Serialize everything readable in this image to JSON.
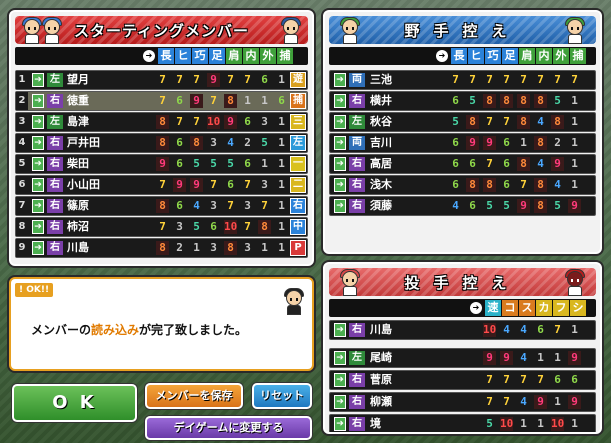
{
  "starting": {
    "title": "スターティングメンバー",
    "headers": [
      "長",
      "ヒ",
      "巧",
      "足",
      "肩",
      "内",
      "外",
      "捕"
    ],
    "rows": [
      {
        "num": "1",
        "hand": "左",
        "name": "望月",
        "stats": [
          "7",
          "7",
          "7",
          "9",
          "7",
          "7",
          "6",
          "1"
        ],
        "pos": "遊"
      },
      {
        "num": "2",
        "hand": "右",
        "name": "徳重",
        "stats": [
          "7",
          "6",
          "9",
          "7",
          "8",
          "1",
          "1",
          "6"
        ],
        "pos": "捕"
      },
      {
        "num": "3",
        "hand": "左",
        "name": "島津",
        "stats": [
          "8",
          "7",
          "7",
          "10",
          "9",
          "6",
          "3",
          "1"
        ],
        "pos": "三"
      },
      {
        "num": "4",
        "hand": "右",
        "name": "戸井田",
        "stats": [
          "8",
          "6",
          "8",
          "3",
          "4",
          "2",
          "5",
          "1"
        ],
        "pos": "左"
      },
      {
        "num": "5",
        "hand": "右",
        "name": "柴田",
        "stats": [
          "9",
          "6",
          "5",
          "5",
          "5",
          "6",
          "1",
          "1"
        ],
        "pos": "一"
      },
      {
        "num": "6",
        "hand": "右",
        "name": "小山田",
        "stats": [
          "7",
          "9",
          "9",
          "7",
          "6",
          "7",
          "3",
          "1"
        ],
        "pos": "二"
      },
      {
        "num": "7",
        "hand": "右",
        "name": "篠原",
        "stats": [
          "8",
          "6",
          "4",
          "3",
          "7",
          "3",
          "7",
          "1"
        ],
        "pos": "右"
      },
      {
        "num": "8",
        "hand": "右",
        "name": "柿沼",
        "stats": [
          "7",
          "3",
          "5",
          "6",
          "10",
          "7",
          "8",
          "1"
        ],
        "pos": "中"
      },
      {
        "num": "9",
        "hand": "右",
        "name": "川島",
        "stats": [
          "8",
          "2",
          "1",
          "3",
          "8",
          "3",
          "1",
          "1"
        ],
        "pos": "P"
      }
    ]
  },
  "fielders_bench": {
    "title": "野手控え",
    "headers": [
      "長",
      "ヒ",
      "巧",
      "足",
      "肩",
      "内",
      "外",
      "捕"
    ],
    "rows": [
      {
        "hand": "両",
        "name": "三池",
        "stats": [
          "7",
          "7",
          "7",
          "7",
          "7",
          "7",
          "7",
          "7"
        ]
      },
      {
        "hand": "右",
        "name": "横井",
        "stats": [
          "6",
          "5",
          "8",
          "8",
          "8",
          "8",
          "5",
          "1"
        ]
      },
      {
        "hand": "左",
        "name": "秋谷",
        "stats": [
          "5",
          "8",
          "7",
          "7",
          "8",
          "4",
          "8",
          "1"
        ]
      },
      {
        "hand": "両",
        "name": "吉川",
        "stats": [
          "6",
          "9",
          "9",
          "6",
          "1",
          "8",
          "2",
          "1"
        ]
      },
      {
        "hand": "右",
        "name": "高居",
        "stats": [
          "6",
          "6",
          "7",
          "6",
          "8",
          "4",
          "9",
          "1"
        ]
      },
      {
        "hand": "右",
        "name": "浅木",
        "stats": [
          "6",
          "8",
          "8",
          "6",
          "7",
          "8",
          "4",
          "1"
        ]
      },
      {
        "hand": "右",
        "name": "須藤",
        "stats": [
          "4",
          "6",
          "5",
          "5",
          "9",
          "8",
          "5",
          "9"
        ]
      }
    ]
  },
  "pitchers_bench": {
    "title": "投手控え",
    "headers": [
      "速",
      "コ",
      "ス",
      "カ",
      "フ",
      "シ"
    ],
    "rows": [
      {
        "hand": "右",
        "name": "川島",
        "stats": [
          "10",
          "4",
          "4",
          "6",
          "7",
          "1"
        ]
      },
      {
        "hand": "左",
        "name": "尾崎",
        "stats": [
          "9",
          "9",
          "4",
          "1",
          "1",
          "9"
        ]
      },
      {
        "hand": "右",
        "name": "菅原",
        "stats": [
          "7",
          "7",
          "7",
          "7",
          "6",
          "6"
        ]
      },
      {
        "hand": "右",
        "name": "柳瀬",
        "stats": [
          "7",
          "7",
          "4",
          "9",
          "1",
          "9"
        ]
      },
      {
        "hand": "右",
        "name": "境",
        "stats": [
          "5",
          "10",
          "1",
          "1",
          "10",
          "1"
        ]
      }
    ]
  },
  "message": {
    "label": "OK!!",
    "pre": "メンバーの",
    "highlight": "読み込み",
    "post": "が完了致しました。"
  },
  "buttons": {
    "ok": "O K",
    "save": "メンバーを保存",
    "reset": "リセット",
    "dayGame": "デイゲームに変更する"
  },
  "colors": {
    "accentRed": "#b71c1c",
    "accentBlue": "#1f5fa8"
  }
}
